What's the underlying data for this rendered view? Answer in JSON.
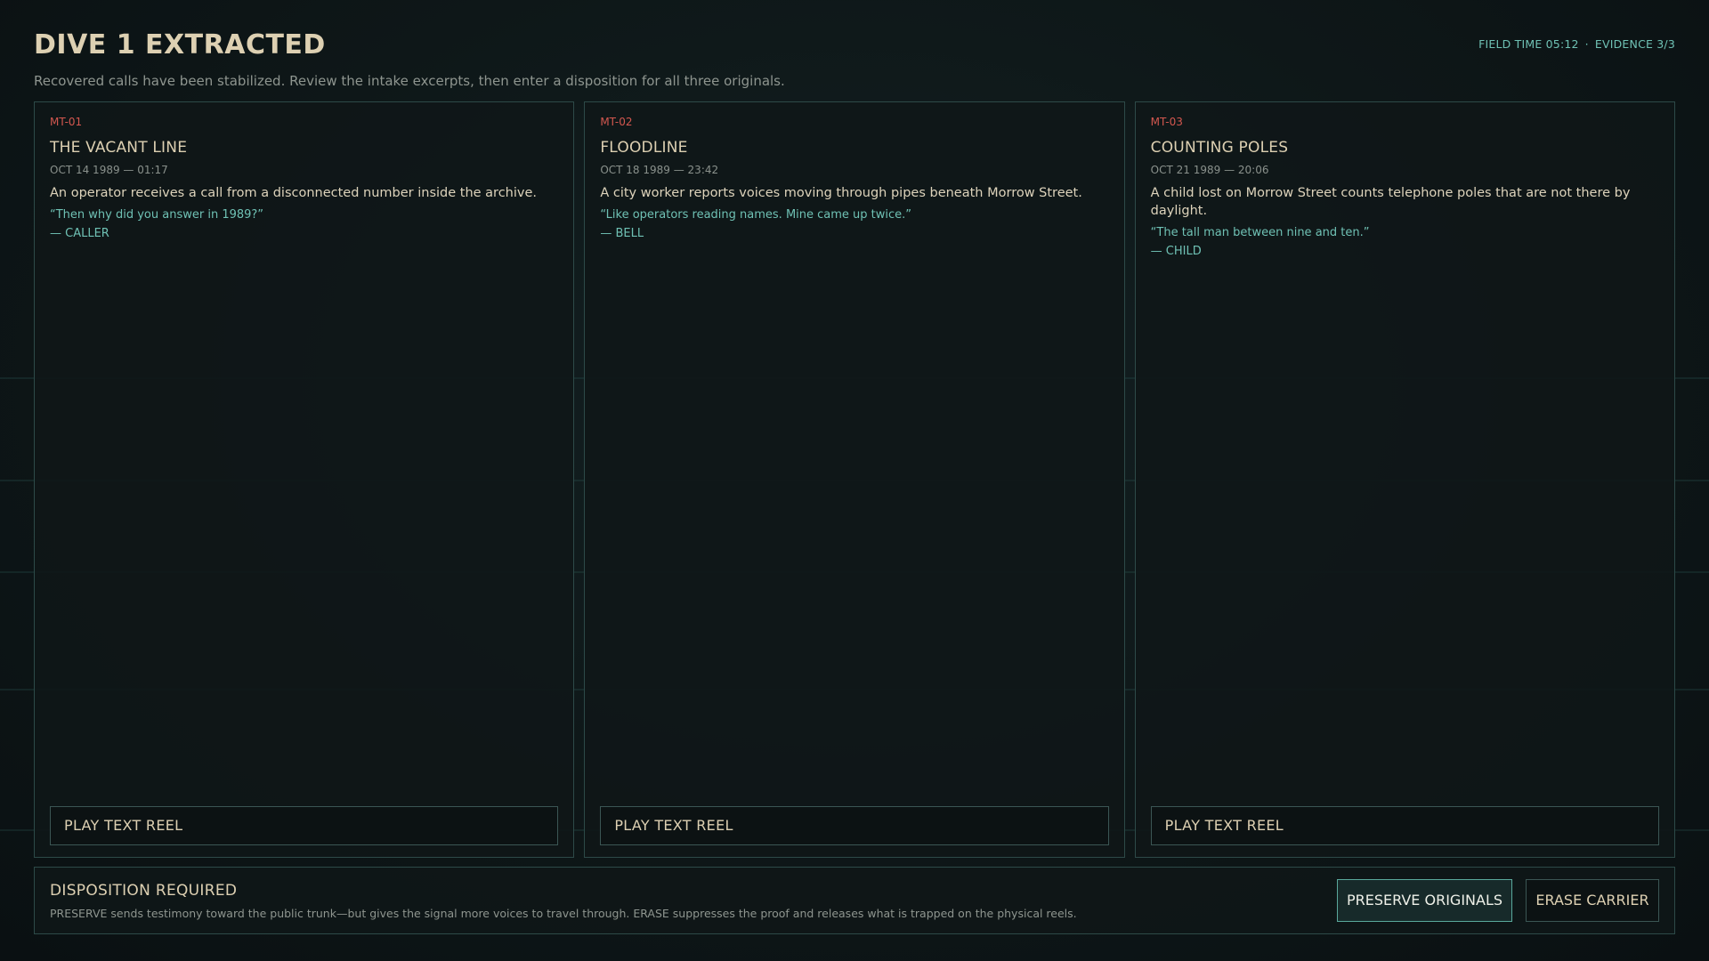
{
  "header": {
    "title": "DIVE 1 EXTRACTED",
    "subtitle": "Recovered calls have been stabilized. Review the intake excerpts, then enter a disposition for all three originals.",
    "field_time": "FIELD TIME 05:12",
    "separator": "·",
    "evidence": "EVIDENCE 3/3"
  },
  "cards": [
    {
      "id": "MT-01",
      "title": "THE VACANT LINE",
      "date": "OCT 14 1989 — 01:17",
      "description": "An operator receives a call from a disconnected number inside the archive.",
      "quote": "“Then why did you answer in 1989?”",
      "speaker": "— CALLER",
      "button_label": "PLAY TEXT REEL"
    },
    {
      "id": "MT-02",
      "title": "FLOODLINE",
      "date": "OCT 18 1989 — 23:42",
      "description": "A city worker reports voices moving through pipes beneath Morrow Street.",
      "quote": "“Like operators reading names. Mine came up twice.”",
      "speaker": "— BELL",
      "button_label": "PLAY TEXT REEL"
    },
    {
      "id": "MT-03",
      "title": "COUNTING POLES",
      "date": "OCT 21 1989 — 20:06",
      "description": "A child lost on Morrow Street counts telephone poles that are not there by daylight.",
      "quote": "“The tall man between nine and ten.”",
      "speaker": "— CHILD",
      "button_label": "PLAY TEXT REEL"
    }
  ],
  "disposition": {
    "title": "DISPOSITION REQUIRED",
    "description": "PRESERVE sends testimony toward the public trunk—but gives the signal more voices to travel through. ERASE suppresses the proof and releases what is trapped on the physical reels.",
    "preserve_label": "PRESERVE ORIGINALS",
    "erase_label": "ERASE CARRIER"
  },
  "colors": {
    "accent_teal": "#6fc1b4",
    "id_red": "#d3574f",
    "text_cream": "#ddd0b2",
    "background": "#0d1416"
  }
}
